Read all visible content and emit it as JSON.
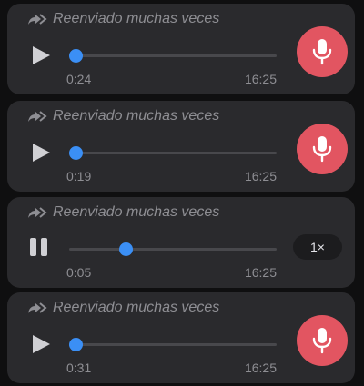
{
  "chat": {
    "messages": [
      {
        "forwarded_label": "Reenviado muchas veces",
        "state": "paused",
        "duration": "0:24",
        "time": "16:25",
        "progress": 0.0,
        "mic_icon": "microphone-icon"
      },
      {
        "forwarded_label": "Reenviado muchas veces",
        "state": "paused",
        "duration": "0:19",
        "time": "16:25",
        "progress": 0.0,
        "mic_icon": "microphone-icon"
      },
      {
        "forwarded_label": "Reenviado muchas veces",
        "state": "playing",
        "duration": "0:05",
        "time": "16:25",
        "progress": 0.24,
        "speed_label": "1×"
      },
      {
        "forwarded_label": "Reenviado muchas veces",
        "state": "paused",
        "duration": "0:31",
        "time": "16:25",
        "progress": 0.0,
        "mic_icon": "microphone-icon"
      }
    ]
  },
  "colors": {
    "bubble": "#2a2a2d",
    "accent_blue": "#3b8ff5",
    "mic_red": "#e25561",
    "meta_gray": "#8e8e93"
  }
}
